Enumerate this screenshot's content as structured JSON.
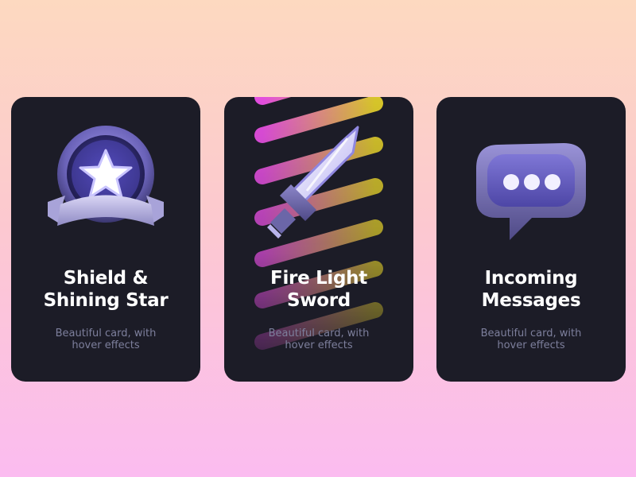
{
  "cards": [
    {
      "title": "Shield &\nShining Star",
      "subtitle": "Beautiful card, with\nhover effects",
      "icon": "shield-star-icon"
    },
    {
      "title": "Fire Light\nSword",
      "subtitle": "Beautiful card, with\nhover effects",
      "icon": "sword-icon"
    },
    {
      "title": "Incoming\nMessages",
      "subtitle": "Beautiful card, with\nhover effects",
      "icon": "chat-bubble-icon"
    }
  ],
  "colors": {
    "card_bg": "#1c1c27",
    "title": "#ffffff",
    "subtitle": "#7d7f9c",
    "icon_purple": "#8e87d8",
    "stripe_pink": "#e44ee0",
    "stripe_yellow": "#d8c62a"
  }
}
